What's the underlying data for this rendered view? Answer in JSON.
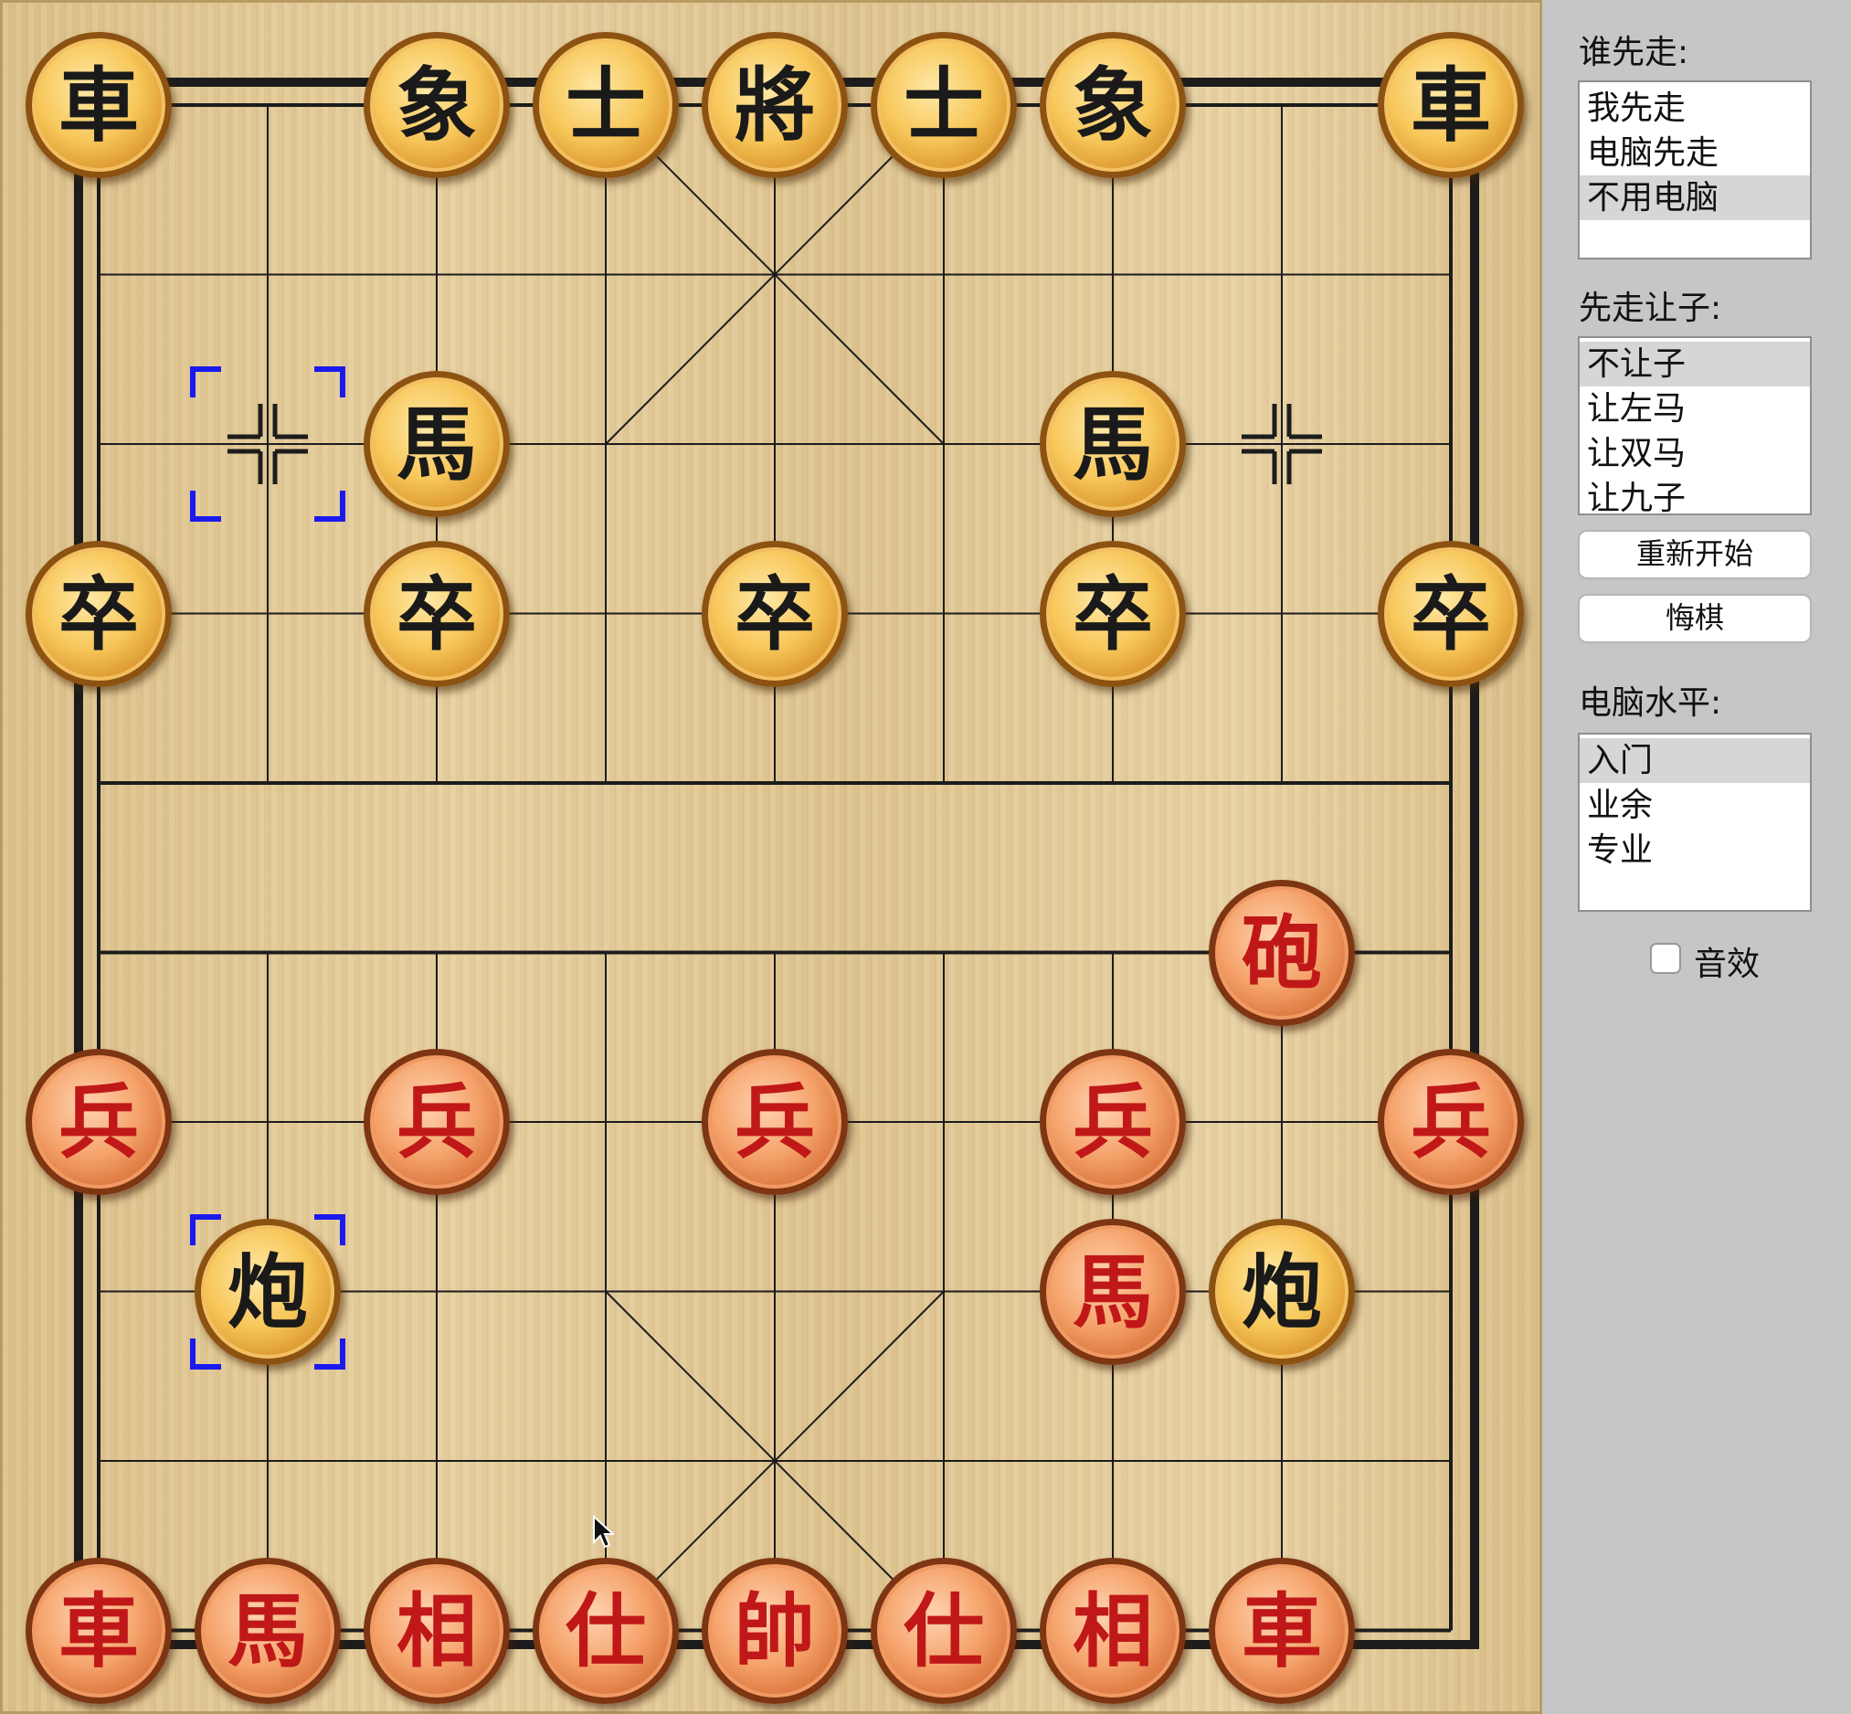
{
  "board": {
    "pieces": [
      {
        "text": "車",
        "side": "black",
        "col": 0,
        "row": 0
      },
      {
        "text": "象",
        "side": "black",
        "col": 2,
        "row": 0
      },
      {
        "text": "士",
        "side": "black",
        "col": 3,
        "row": 0
      },
      {
        "text": "將",
        "side": "black",
        "col": 4,
        "row": 0
      },
      {
        "text": "士",
        "side": "black",
        "col": 5,
        "row": 0
      },
      {
        "text": "象",
        "side": "black",
        "col": 6,
        "row": 0
      },
      {
        "text": "車",
        "side": "black",
        "col": 8,
        "row": 0
      },
      {
        "text": "馬",
        "side": "black",
        "col": 2,
        "row": 2
      },
      {
        "text": "馬",
        "side": "black",
        "col": 6,
        "row": 2
      },
      {
        "text": "卒",
        "side": "black",
        "col": 0,
        "row": 3
      },
      {
        "text": "卒",
        "side": "black",
        "col": 2,
        "row": 3
      },
      {
        "text": "卒",
        "side": "black",
        "col": 4,
        "row": 3
      },
      {
        "text": "卒",
        "side": "black",
        "col": 6,
        "row": 3
      },
      {
        "text": "卒",
        "side": "black",
        "col": 8,
        "row": 3
      },
      {
        "text": "炮",
        "side": "black",
        "col": 1,
        "row": 7
      },
      {
        "text": "炮",
        "side": "black",
        "col": 7,
        "row": 7
      },
      {
        "text": "砲",
        "side": "red",
        "col": 7,
        "row": 5
      },
      {
        "text": "兵",
        "side": "red",
        "col": 0,
        "row": 6
      },
      {
        "text": "兵",
        "side": "red",
        "col": 2,
        "row": 6
      },
      {
        "text": "兵",
        "side": "red",
        "col": 4,
        "row": 6
      },
      {
        "text": "兵",
        "side": "red",
        "col": 6,
        "row": 6
      },
      {
        "text": "兵",
        "side": "red",
        "col": 8,
        "row": 6
      },
      {
        "text": "馬",
        "side": "red",
        "col": 6,
        "row": 7
      },
      {
        "text": "車",
        "side": "red",
        "col": 0,
        "row": 9
      },
      {
        "text": "馬",
        "side": "red",
        "col": 1,
        "row": 9
      },
      {
        "text": "相",
        "side": "red",
        "col": 2,
        "row": 9
      },
      {
        "text": "仕",
        "side": "red",
        "col": 3,
        "row": 9
      },
      {
        "text": "帥",
        "side": "red",
        "col": 4,
        "row": 9
      },
      {
        "text": "仕",
        "side": "red",
        "col": 5,
        "row": 9
      },
      {
        "text": "相",
        "side": "red",
        "col": 6,
        "row": 9
      },
      {
        "text": "車",
        "side": "red",
        "col": 7,
        "row": 9
      }
    ],
    "last_move_markers": [
      {
        "col": 1,
        "row": 2
      },
      {
        "col": 1,
        "row": 7
      }
    ],
    "empty_point_marks": [
      {
        "col": 1,
        "row": 2
      },
      {
        "col": 7,
        "row": 2
      }
    ],
    "colors": {
      "line": "#1c1c1c",
      "marker": "#1a1aee",
      "red_text": "#c01818",
      "black_text": "#1a1a1a"
    }
  },
  "panel": {
    "who_first": {
      "label": "谁先走:",
      "options": [
        "我先走",
        "电脑先走",
        "不用电脑"
      ],
      "selected_index": 2
    },
    "handicap": {
      "label": "先走让子:",
      "options": [
        "不让子",
        "让左马",
        "让双马",
        "让九子"
      ],
      "selected_index": 0
    },
    "buttons": {
      "restart": "重新开始",
      "undo": "悔棋"
    },
    "level": {
      "label": "电脑水平:",
      "options": [
        "入门",
        "业余",
        "专业"
      ],
      "selected_index": 0
    },
    "sound": {
      "label": "音效",
      "checked": false
    }
  }
}
